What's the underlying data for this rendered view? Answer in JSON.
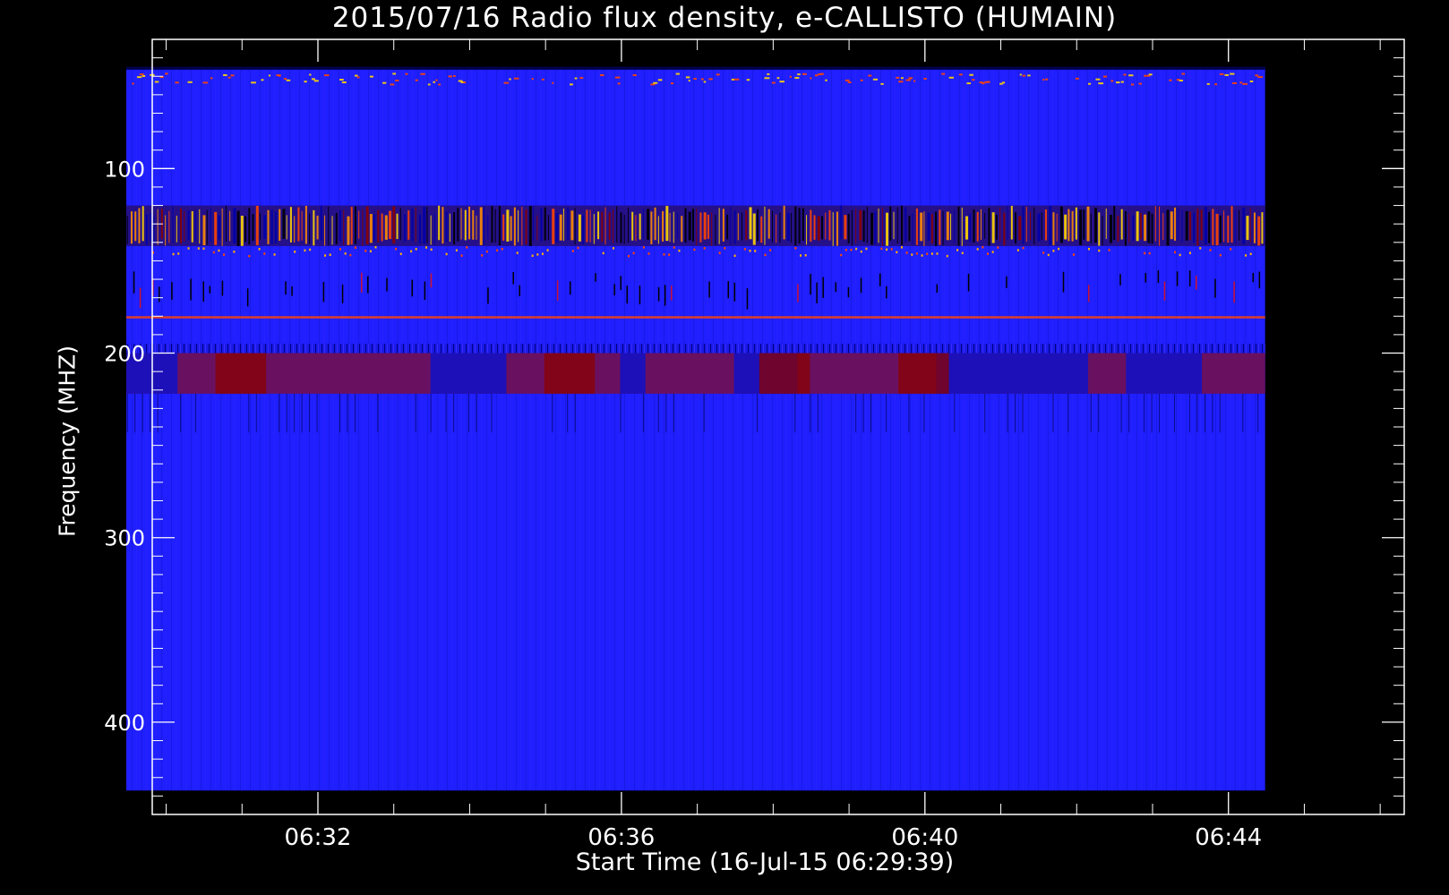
{
  "chart_data": {
    "type": "heatmap",
    "title": "2015/07/16  Radio flux density, e-CALLISTO (HUMAIN)",
    "xlabel": "Start Time (16-Jul-15 06:29:39)",
    "ylabel": "Frequency (MHZ)",
    "x_ticks": [
      "06:32",
      "06:36",
      "06:40",
      "06:44"
    ],
    "x_tick_minutes": [
      151,
      391,
      631,
      871
    ],
    "x_range_minutes": [
      20,
      1010
    ],
    "data_x_range_minutes": [
      -0.5,
      900
    ],
    "y_ticks": [
      "100",
      "200",
      "300",
      "400"
    ],
    "y_tick_values": [
      100,
      200,
      300,
      400
    ],
    "y_range": [
      30,
      450
    ],
    "y_reversed": true,
    "data_y_range": [
      45,
      437
    ],
    "colormap": [
      "#000000",
      "#0000ff",
      "#8b0000",
      "#ff4500",
      "#ffd700"
    ],
    "background_color": "#1f1fff",
    "features": [
      {
        "freq_range": [
          45,
          50
        ],
        "description": "strong interference band",
        "color": "#ff4500"
      },
      {
        "freq_range": [
          120,
          142
        ],
        "description": "intermittent bright bursts",
        "color": "#ffd700"
      },
      {
        "freq_range": [
          142,
          148
        ],
        "description": "speckled emission",
        "color": "#ff4500"
      },
      {
        "freq_range": [
          155,
          175
        ],
        "description": "dark dropouts",
        "color": "#000000"
      },
      {
        "freq_range": [
          180,
          182
        ],
        "description": "narrow band",
        "color": "#ff4500"
      },
      {
        "freq_range": [
          195,
          200
        ],
        "description": "striped band",
        "color": "#000000"
      },
      {
        "freq_range": [
          200,
          222
        ],
        "description": "dark red band",
        "color": "#8b0000"
      }
    ]
  }
}
